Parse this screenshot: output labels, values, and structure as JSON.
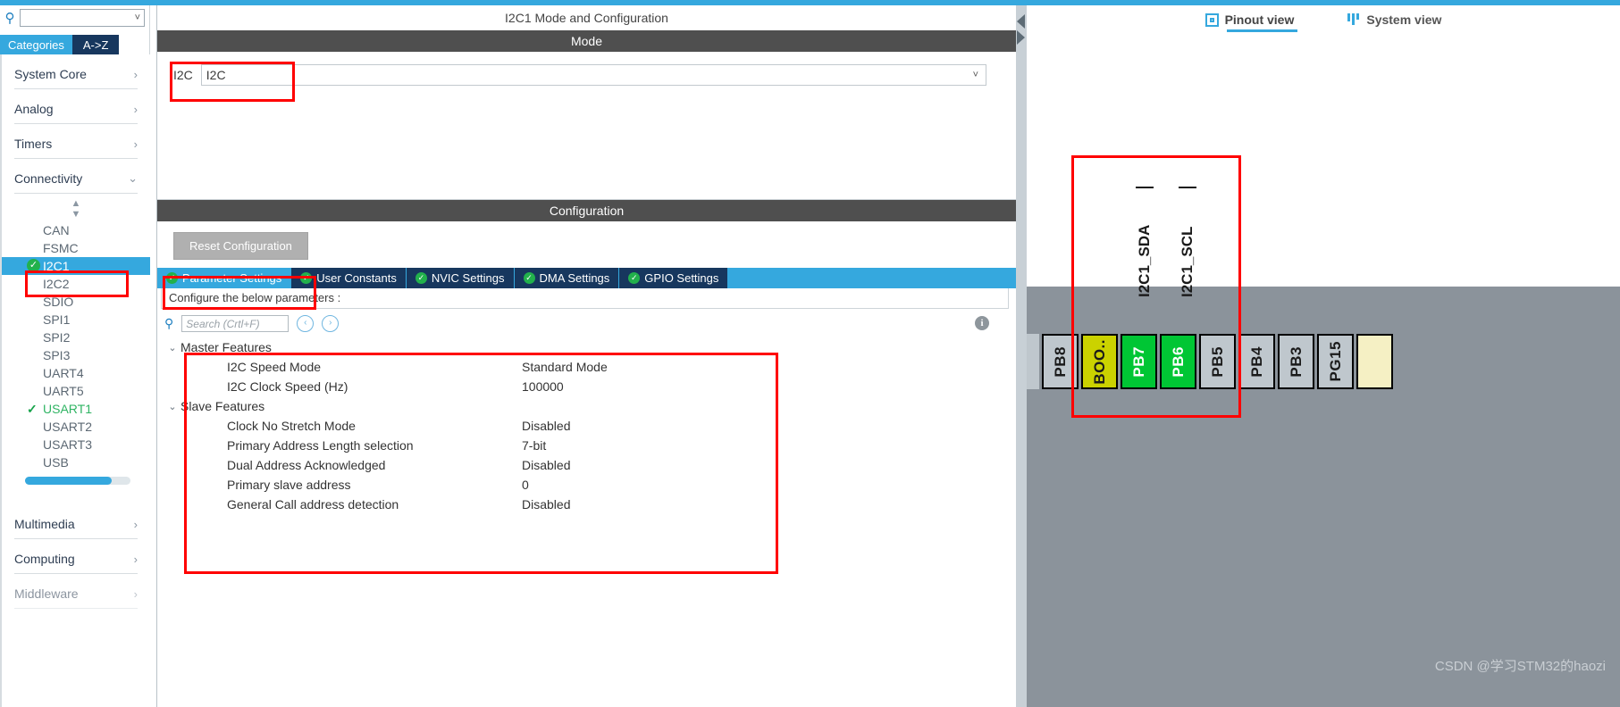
{
  "sidebar": {
    "search": {
      "value": "",
      "placeholder": ""
    },
    "tabs": {
      "categories": "Categories",
      "az": "A->Z"
    },
    "groups": [
      {
        "label": "System Core",
        "chev": "›"
      },
      {
        "label": "Analog",
        "chev": "›"
      },
      {
        "label": "Timers",
        "chev": "›"
      },
      {
        "label": "Connectivity",
        "chev": "⌄"
      }
    ],
    "peripherals": [
      {
        "label": "CAN",
        "state": "none"
      },
      {
        "label": "FSMC",
        "state": "none"
      },
      {
        "label": "I2C1",
        "state": "configured-selected"
      },
      {
        "label": "I2C2",
        "state": "none"
      },
      {
        "label": "SDIO",
        "state": "none"
      },
      {
        "label": "SPI1",
        "state": "none"
      },
      {
        "label": "SPI2",
        "state": "none"
      },
      {
        "label": "SPI3",
        "state": "none"
      },
      {
        "label": "UART4",
        "state": "none"
      },
      {
        "label": "UART5",
        "state": "none"
      },
      {
        "label": "USART1",
        "state": "check"
      },
      {
        "label": "USART2",
        "state": "none"
      },
      {
        "label": "USART3",
        "state": "none"
      },
      {
        "label": "USB",
        "state": "none"
      }
    ],
    "bottom_groups": [
      {
        "label": "Multimedia",
        "chev": "›"
      },
      {
        "label": "Computing",
        "chev": "›"
      },
      {
        "label": "Middleware",
        "chev": "›"
      }
    ]
  },
  "center": {
    "panel_title": "I2C1 Mode and Configuration",
    "mode_header": "Mode",
    "mode": {
      "label": "I2C",
      "value": "I2C",
      "caret": "⌄"
    },
    "config_header": "Configuration",
    "reset_button": "Reset Configuration",
    "tabs": [
      {
        "label": "Parameter Settings",
        "active": true
      },
      {
        "label": "User Constants",
        "active": false
      },
      {
        "label": "NVIC Settings",
        "active": false
      },
      {
        "label": "DMA Settings",
        "active": false
      },
      {
        "label": "GPIO Settings",
        "active": false
      }
    ],
    "configure_note": "Configure the below parameters :",
    "search": {
      "placeholder": "Search (Crtl+F)",
      "value": ""
    },
    "nav_prev": "‹",
    "nav_next": "›",
    "info_icon": "i",
    "param_groups": [
      {
        "title": "Master Features",
        "expander": "⌄",
        "rows": [
          {
            "name": "I2C Speed Mode",
            "value": "Standard Mode"
          },
          {
            "name": "I2C Clock Speed (Hz)",
            "value": "100000"
          }
        ]
      },
      {
        "title": "Slave Features",
        "expander": "⌄",
        "rows": [
          {
            "name": "Clock No Stretch Mode",
            "value": "Disabled"
          },
          {
            "name": "Primary Address Length selection",
            "value": "7-bit"
          },
          {
            "name": "Dual Address Acknowledged",
            "value": "Disabled"
          },
          {
            "name": "Primary slave address",
            "value": "0"
          },
          {
            "name": "General Call address detection",
            "value": "Disabled"
          }
        ]
      }
    ]
  },
  "right": {
    "view_tabs": [
      {
        "label": "Pinout view",
        "active": true
      },
      {
        "label": "System view",
        "active": false
      }
    ],
    "signals": [
      {
        "label": "I2C1_SDA"
      },
      {
        "label": "I2C1_SCL"
      }
    ],
    "pins": [
      {
        "label": "PB8",
        "color": "gray"
      },
      {
        "label": "BOO..",
        "color": "yellow"
      },
      {
        "label": "PB7",
        "color": "green"
      },
      {
        "label": "PB6",
        "color": "green"
      },
      {
        "label": "PB5",
        "color": "gray"
      },
      {
        "label": "PB4",
        "color": "gray"
      },
      {
        "label": "PB3",
        "color": "gray"
      },
      {
        "label": "PG15",
        "color": "gray"
      },
      {
        "label": "",
        "color": "cream"
      }
    ],
    "watermark": "CSDN @学习STM32的haozi"
  },
  "colors": {
    "accent": "#35a8de",
    "tab_dark": "#17375e",
    "ok_green": "#22b14c",
    "highlight_red": "#ff0000",
    "pin_green": "#00c634",
    "pin_yellow": "#cbd200",
    "panel_dark": "#4f4f4f"
  }
}
